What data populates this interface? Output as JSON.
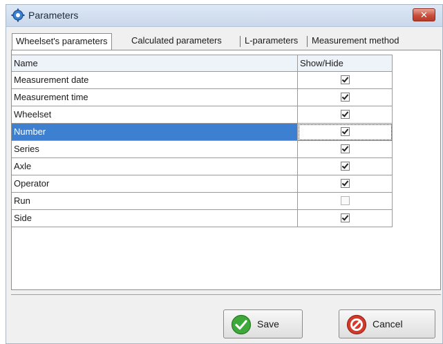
{
  "window": {
    "title": "Parameters",
    "close_symbol": "✕"
  },
  "tabs": [
    {
      "label": "Wheelset's parameters",
      "active": true
    },
    {
      "label": "Calculated parameters",
      "active": false
    },
    {
      "label": "L-parameters",
      "active": false
    },
    {
      "label": "Measurement method",
      "active": false
    }
  ],
  "grid": {
    "columns": [
      "Name",
      "Show/Hide"
    ],
    "rows": [
      {
        "name": "Measurement date",
        "checked": true
      },
      {
        "name": "Measurement time",
        "checked": true
      },
      {
        "name": "Wheelset",
        "checked": true
      },
      {
        "name": "Number",
        "checked": true,
        "selected": true
      },
      {
        "name": "Series",
        "checked": true
      },
      {
        "name": "Axle",
        "checked": true
      },
      {
        "name": "Operator",
        "checked": true
      },
      {
        "name": "Run",
        "checked": false
      },
      {
        "name": "Side",
        "checked": true
      }
    ]
  },
  "buttons": {
    "save": {
      "label": "Save",
      "icon": "green-check-icon",
      "color": "#3ea83a"
    },
    "cancel": {
      "label": "Cancel",
      "icon": "red-no-icon",
      "color": "#d43a2c"
    }
  },
  "colors": {
    "selection": "#3d7fd0",
    "title_bar": "#c9d8ea"
  }
}
